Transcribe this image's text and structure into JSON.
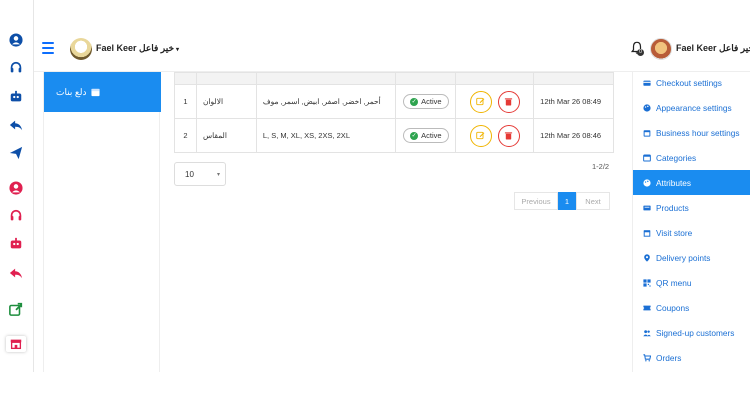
{
  "header": {
    "store_name": "Fael Keer خير فاعل",
    "user_name": "Fael Keer خير فاعل",
    "notification_count": "0",
    "caret": "▾"
  },
  "categories": {
    "active_label": "دلع بنات"
  },
  "table": {
    "rows": [
      {
        "index": "1",
        "name": "الالوان",
        "values": "أحمر, اخضر, اصفر, ابيض, اسمر, موف",
        "status": "Active",
        "date": "12th Mar 26 08:49"
      },
      {
        "index": "2",
        "name": "المقاس",
        "values": "L, S, M, XL, XS, 2XS, 2XL",
        "status": "Active",
        "date": "12th Mar 26 08:46"
      }
    ]
  },
  "pagination": {
    "per_page": "10",
    "count": "1-2/2",
    "previous": "Previous",
    "current": "1",
    "next": "Next"
  },
  "settings_menu": {
    "items": [
      {
        "label": "Checkout settings",
        "icon": "credit-card-icon"
      },
      {
        "label": "Appearance settings",
        "icon": "palette-icon"
      },
      {
        "label": "Business hour settings",
        "icon": "calendar-icon"
      },
      {
        "label": "Categories",
        "icon": "window-icon"
      },
      {
        "label": "Attributes",
        "icon": "palette-icon"
      },
      {
        "label": "Products",
        "icon": "boxes-icon"
      },
      {
        "label": "Visit store",
        "icon": "store-icon"
      },
      {
        "label": "Delivery points",
        "icon": "map-pin-icon"
      },
      {
        "label": "QR menu",
        "icon": "qr-icon"
      },
      {
        "label": "Coupons",
        "icon": "coupon-icon"
      },
      {
        "label": "Signed-up customers",
        "icon": "users-icon"
      },
      {
        "label": "Orders",
        "icon": "cart-icon"
      }
    ],
    "active_index": 4
  },
  "colors": {
    "primary": "#1a8cf0",
    "rail_blue": "#0d4fa8",
    "rail_red": "#e02050",
    "active_green": "#2ea44f",
    "edit": "#f0b400",
    "delete": "#e53935"
  }
}
